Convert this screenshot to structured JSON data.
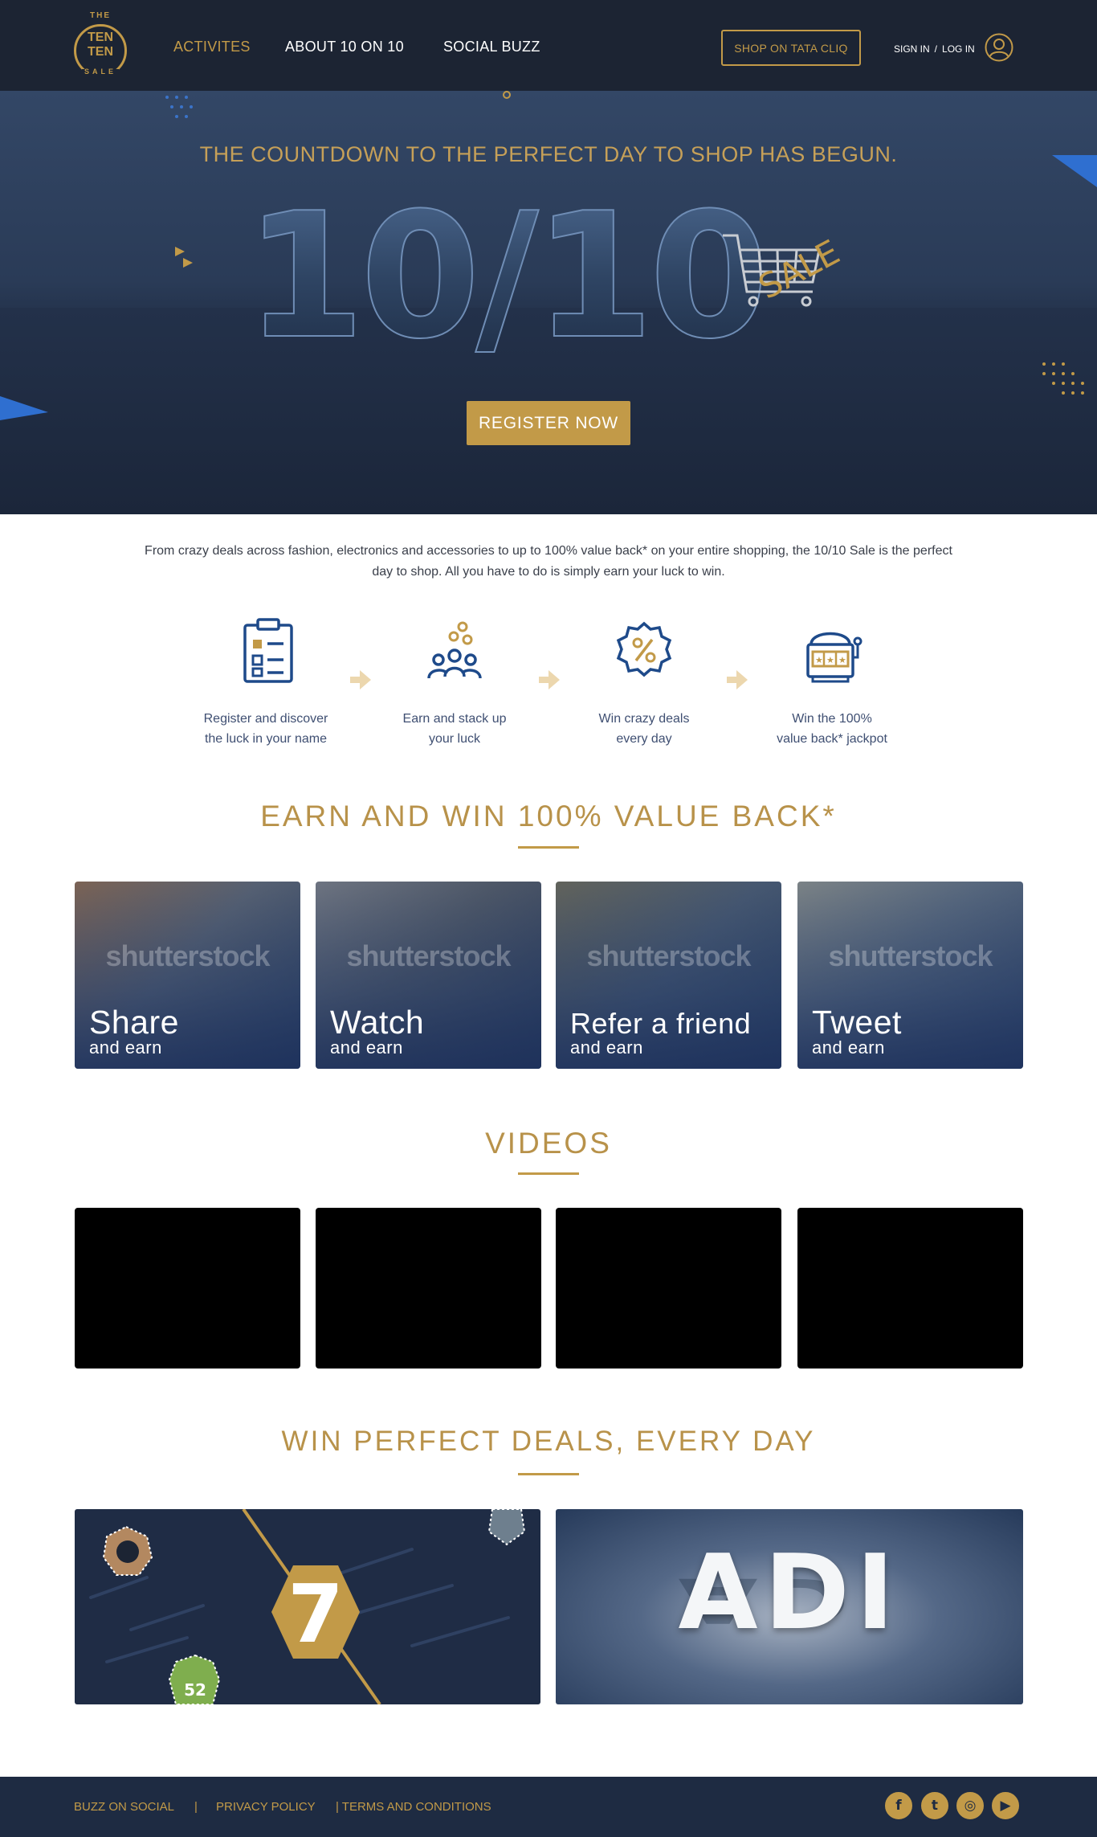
{
  "header": {
    "logo": {
      "top": "THE",
      "line1": "TEN",
      "line2": "TEN",
      "bottom": "SALE"
    },
    "nav": [
      {
        "label": "ACTIVITES",
        "active": true
      },
      {
        "label": "ABOUT 10 ON 10",
        "active": false
      },
      {
        "label": "SOCIAL BUZZ",
        "active": false
      }
    ],
    "shop_button": "SHOP ON TATA CLIQ",
    "sign_in": "SIGN IN",
    "separator": "/",
    "log_in": "LOG IN",
    "user_icon": "user-circle-icon"
  },
  "hero": {
    "tagline": "THE COUNTDOWN TO THE PERFECT DAY TO SHOP HAS BEGUN.",
    "title": "10/10",
    "title_badge": "SALE",
    "register_button": "REGISTER NOW"
  },
  "intro": {
    "text": "From crazy deals across fashion, electronics and accessories to up to 100% value back* on your entire shopping, the 10/10 Sale is the perfect day to shop. All you have to do is simply earn your luck to win."
  },
  "steps": [
    {
      "icon": "clipboard-checklist-icon",
      "line1": "Register and discover",
      "line2": "the luck in your name"
    },
    {
      "icon": "people-group-icon",
      "line1": "Earn and stack up",
      "line2": "your luck"
    },
    {
      "icon": "percent-badge-icon",
      "line1": "Win crazy deals",
      "line2": "every day"
    },
    {
      "icon": "slot-machine-icon",
      "line1": "Win the 100%",
      "line2": "value back* jackpot"
    }
  ],
  "earn": {
    "title": "EARN AND WIN 100% VALUE BACK*",
    "watermark": "shutterstock",
    "cards": [
      {
        "title": "Share",
        "subtitle": "and earn"
      },
      {
        "title": "Watch",
        "subtitle": "and earn"
      },
      {
        "title": "Refer a friend",
        "subtitle": "and earn"
      },
      {
        "title": "Tweet",
        "subtitle": "and earn"
      }
    ]
  },
  "videos": {
    "title": "VIDEOS",
    "count": 4
  },
  "deals": {
    "title": "WIN PERFECT DEALS, EVERY DAY",
    "countdown_number": "7",
    "jersey_number": "52",
    "brand_text": "ADI"
  },
  "footer": {
    "links": [
      "BUZZ ON SOCIAL",
      "PRIVACY POLICY",
      "| TERMS AND CONDITIONS"
    ],
    "separator": "|",
    "social": [
      {
        "icon": "facebook-icon",
        "glyph": "f"
      },
      {
        "icon": "twitter-icon",
        "glyph": "t"
      },
      {
        "icon": "instagram-icon",
        "glyph": "◎"
      },
      {
        "icon": "youtube-icon",
        "glyph": "▶"
      }
    ]
  },
  "colors": {
    "gold": "#c29a48",
    "navy": "#1c2433",
    "footer_navy": "#1e2b42",
    "step_blue": "#1e4a8a"
  }
}
